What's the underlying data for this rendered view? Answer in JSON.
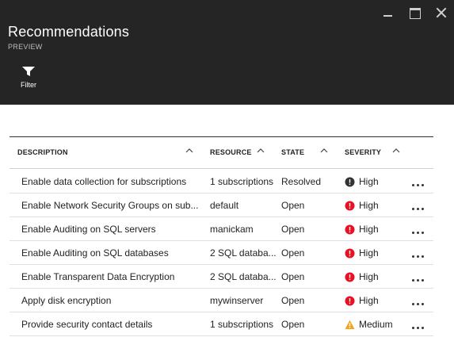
{
  "header": {
    "title": "Recommendations",
    "subtitle": "PREVIEW",
    "filter_label": "Filter",
    "background": "#252526"
  },
  "table": {
    "columns": [
      "DESCRIPTION",
      "RESOURCE",
      "STATE",
      "SEVERITY"
    ],
    "rows": [
      {
        "description": "Enable data collection for subscriptions",
        "resource": "1 subscriptions",
        "state": "Resolved",
        "severity": "High",
        "severity_icon": "info-dark-icon"
      },
      {
        "description": "Enable Network Security Groups on sub...",
        "resource": "default",
        "state": "Open",
        "severity": "High",
        "severity_icon": "error-red-icon"
      },
      {
        "description": "Enable Auditing on SQL servers",
        "resource": "manickam",
        "state": "Open",
        "severity": "High",
        "severity_icon": "error-red-icon"
      },
      {
        "description": "Enable Auditing on SQL databases",
        "resource": "2 SQL databa...",
        "state": "Open",
        "severity": "High",
        "severity_icon": "error-red-icon"
      },
      {
        "description": "Enable Transparent Data Encryption",
        "resource": "2 SQL databa...",
        "state": "Open",
        "severity": "High",
        "severity_icon": "error-red-icon"
      },
      {
        "description": "Apply disk encryption",
        "resource": "mywinserver",
        "state": "Open",
        "severity": "High",
        "severity_icon": "error-red-icon"
      },
      {
        "description": "Provide security contact details",
        "resource": "1 subscriptions",
        "state": "Open",
        "severity": "Medium",
        "severity_icon": "warning-orange-icon"
      }
    ]
  },
  "colors": {
    "high_resolved": "#333333",
    "high_open": "#e81123",
    "medium": "#f2a51a"
  }
}
